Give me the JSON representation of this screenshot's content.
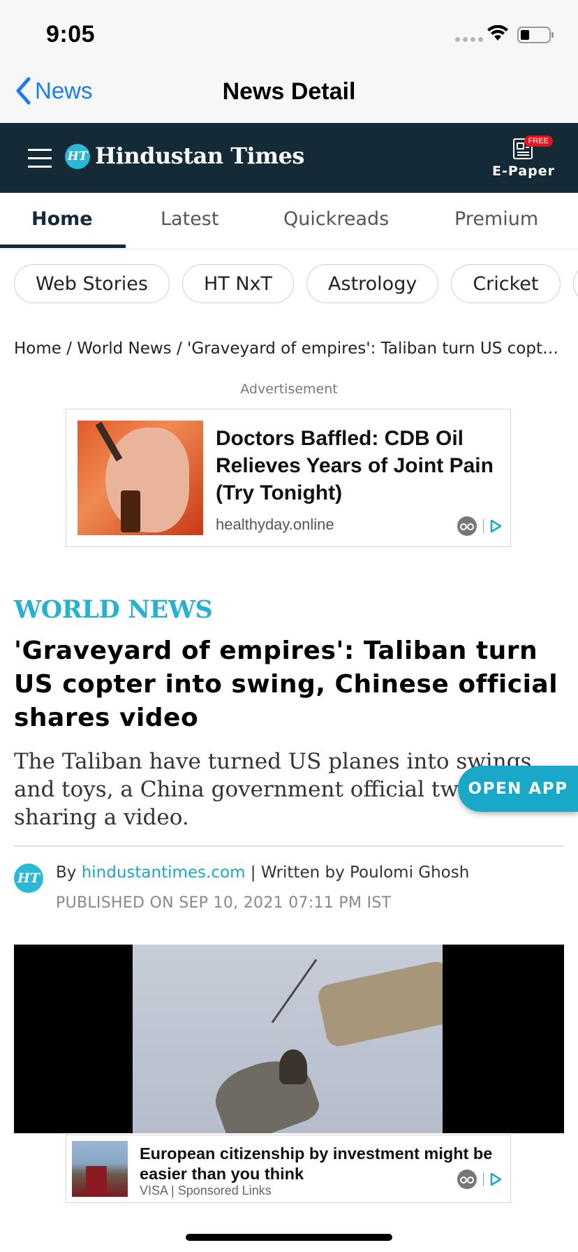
{
  "status_bar": {
    "time": "9:05"
  },
  "nav_bar": {
    "back_label": "News",
    "title": "News Detail"
  },
  "site_header": {
    "logo_mark": "HT",
    "logo_text": "Hindustan Times",
    "epaper_label": "E-Paper",
    "epaper_badge": "FREE"
  },
  "tabs": [
    {
      "label": "Home",
      "active": true
    },
    {
      "label": "Latest"
    },
    {
      "label": "Quickreads"
    },
    {
      "label": "Premium"
    }
  ],
  "chips": [
    "Web Stories",
    "HT NxT",
    "Astrology",
    "Cricket"
  ],
  "breadcrumb": "Home / World News / 'Graveyard of empires': Taliban turn US copter into swing, Chinese official shares video",
  "advertisement": {
    "label": "Advertisement",
    "headline": "Doctors Baffled: CDB Oil Relieves Years of Joint Pain (Try Tonight)",
    "source": "healthyday.online"
  },
  "article": {
    "section": "WORLD NEWS",
    "headline": "'Graveyard of empires': Taliban turn US copter into swing, Chinese official shares video",
    "summary": "The Taliban have turned US planes into swings and toys, a China government official tweeted sharing a video.",
    "byline_prefix": "By",
    "byline_source": "hindustantimes.com",
    "byline_rest": "| Written by Poulomi Ghosh",
    "published": "PUBLISHED ON SEP 10, 2021 07:11 PM IST"
  },
  "bottom_ad": {
    "headline": "European citizenship by investment might be easier than you think",
    "source": "VISA | Sponsored Links"
  },
  "open_app_label": "OPEN APP",
  "colors": {
    "accent": "#27b0cf",
    "header_bg": "#142a37",
    "ios_blue": "#1a7cf4"
  }
}
